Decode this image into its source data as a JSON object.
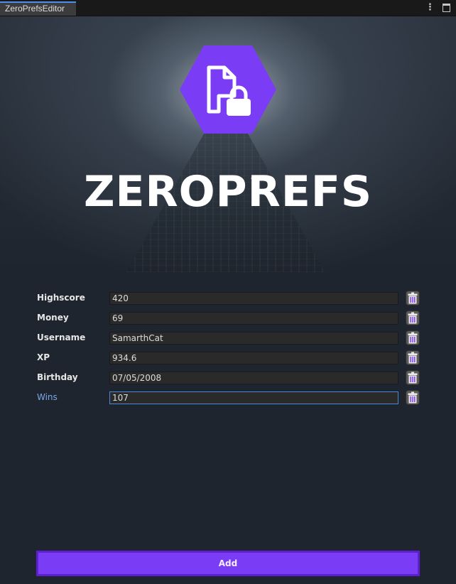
{
  "window": {
    "tab_title": "ZeroPrefsEditor"
  },
  "header": {
    "brand_text": "ZEROPREFS",
    "logo_icon": "file-lock-icon",
    "accent_color": "#7a3cf5"
  },
  "prefs": [
    {
      "label": "Highscore",
      "value": "420"
    },
    {
      "label": "Money",
      "value": "69"
    },
    {
      "label": "Username",
      "value": "SamarthCat"
    },
    {
      "label": "XP",
      "value": "934.6"
    },
    {
      "label": "Birthday",
      "value": "07/05/2008"
    },
    {
      "label": "Wins",
      "value": "107"
    }
  ],
  "footer": {
    "add_label": "Add"
  }
}
